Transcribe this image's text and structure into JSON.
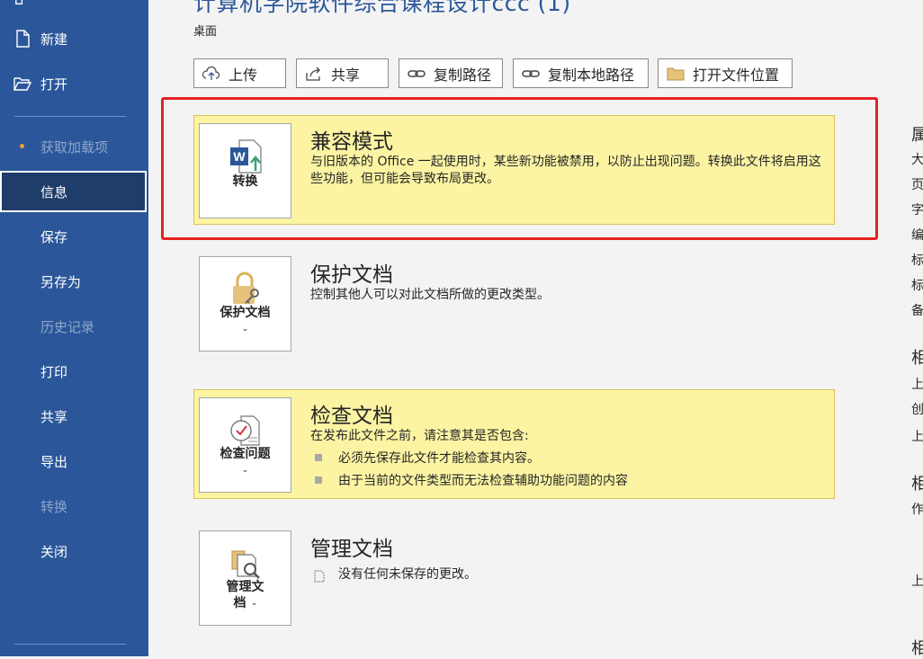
{
  "sidebar": {
    "top_glyph": "⌂",
    "items": [
      {
        "label": "新建"
      },
      {
        "label": "打开"
      },
      {
        "label": "获取加载项"
      },
      {
        "label": "信息"
      },
      {
        "label": "保存"
      },
      {
        "label": "另存为"
      },
      {
        "label": "历史记录"
      },
      {
        "label": "打印"
      },
      {
        "label": "共享"
      },
      {
        "label": "导出"
      },
      {
        "label": "转换"
      },
      {
        "label": "关闭"
      }
    ]
  },
  "header": {
    "title": "计算机学院软件综合课程设计ccc (1)",
    "location": "桌面"
  },
  "toolbar": {
    "upload": "上传",
    "share": "共享",
    "copy_path": "复制路径",
    "copy_local_path": "复制本地路径",
    "open_location": "打开文件位置"
  },
  "compat": {
    "button": "转换",
    "title": "兼容模式",
    "desc": "与旧版本的 Office 一起使用时，某些新功能被禁用，以防止出现问题。转换此文件将启用这些功能，但可能会导致布局更改。"
  },
  "protect": {
    "button": "保护文档",
    "chevron": "⌄",
    "title": "保护文档",
    "desc": "控制其他人可以对此文档所做的更改类型。"
  },
  "inspect": {
    "button": "检查问题",
    "chevron": "⌄",
    "title": "检查文档",
    "desc": "在发布此文件之前，请注意其是否包含:",
    "bullets": [
      "必须先保存此文件才能检查其内容。",
      "由于当前的文件类型而无法检查辅助功能问题的内容"
    ]
  },
  "manage": {
    "button_line1": "管理文",
    "button_line2": "档",
    "chevron": "⌄",
    "title": "管理文档",
    "desc": "没有任何未保存的更改。"
  },
  "right_panel": [
    "属",
    "大",
    "页",
    "字",
    "编",
    "标",
    "标",
    "备",
    "相",
    "上",
    "创",
    "上",
    "相",
    "作",
    "上",
    "相"
  ],
  "colors": {
    "sidebar": "#2b579a",
    "accent_panel": "#fcf4a3",
    "highlight": "#e5221f"
  }
}
